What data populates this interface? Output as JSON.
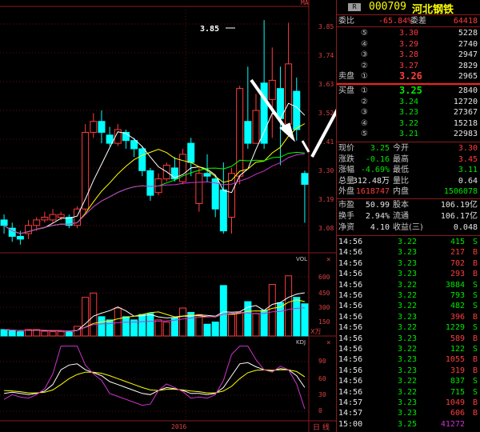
{
  "header": {
    "code": "000709",
    "name": "河北钢铁",
    "badge": "R",
    "top_label": "MA"
  },
  "price_axis": [
    "3.85",
    "3.74",
    "3.63",
    "3.52",
    "3.41",
    "3.30",
    "3.19",
    "3.08"
  ],
  "peak_label": "3.85",
  "vol_axis": {
    "title": "VOL",
    "ticks": [
      "600",
      "450",
      "300",
      "150"
    ],
    "unit": "X万"
  },
  "kdj_axis": {
    "title": "KDJ",
    "ticks": [
      "90",
      "60",
      "30",
      "0"
    ]
  },
  "x_label": "2016",
  "bottom_tabs": [
    "日",
    "线"
  ],
  "webi": {
    "label1": "委比",
    "val1": "-65.84%",
    "label2": "委差",
    "val2": "64418"
  },
  "sell": [
    {
      "n": "⑤",
      "price": "3.30",
      "vol": "5228"
    },
    {
      "n": "④",
      "price": "3.29",
      "vol": "2740"
    },
    {
      "n": "③",
      "price": "3.28",
      "vol": "2947"
    },
    {
      "n": "②",
      "price": "3.27",
      "vol": "2829"
    },
    {
      "n": "①",
      "price": "3.26",
      "vol": "2965",
      "label": "卖盘"
    }
  ],
  "buy": [
    {
      "n": "①",
      "price": "3.25",
      "vol": "2840",
      "label": "买盘"
    },
    {
      "n": "②",
      "price": "3.24",
      "vol": "12720"
    },
    {
      "n": "③",
      "price": "3.23",
      "vol": "27367"
    },
    {
      "n": "④",
      "price": "3.22",
      "vol": "15218"
    },
    {
      "n": "⑤",
      "price": "3.21",
      "vol": "22983"
    }
  ],
  "stats": [
    {
      "l1": "现价",
      "v1": "3.25",
      "l2": "今开",
      "v2": "3.30",
      "c1": "grn",
      "c2": "red"
    },
    {
      "l1": "涨跌",
      "v1": "-0.16",
      "l2": "最高",
      "v2": "3.45",
      "c1": "grn",
      "c2": "red"
    },
    {
      "l1": "涨幅",
      "v1": "-4.69%",
      "l2": "最低",
      "v2": "3.11",
      "c1": "grn",
      "c2": "grn"
    },
    {
      "l1": "总量",
      "v1": "312.48万",
      "l2": "量比",
      "v2": "0.64",
      "c1": "wht",
      "c2": "wht"
    },
    {
      "l1": "外盘",
      "v1": "1618747",
      "l2": "内盘",
      "v2": "1506078",
      "c1": "red",
      "c2": "grn"
    }
  ],
  "stats2": [
    {
      "l1": "市盈",
      "v1": "50.99",
      "l2": "股本",
      "v2": "106.19亿"
    },
    {
      "l1": "换手",
      "v1": "2.94%",
      "l2": "流通",
      "v2": "106.17亿"
    },
    {
      "l1": "净资",
      "v1": "4.10",
      "l2": "收益(三)",
      "v2": "0.048"
    }
  ],
  "ticks": [
    {
      "t": "14:56",
      "p": "3.22",
      "v": "415",
      "s": "S"
    },
    {
      "t": "14:56",
      "p": "3.23",
      "v": "217",
      "s": "B"
    },
    {
      "t": "14:56",
      "p": "3.23",
      "v": "702",
      "s": "B"
    },
    {
      "t": "14:56",
      "p": "3.23",
      "v": "293",
      "s": "B"
    },
    {
      "t": "14:56",
      "p": "3.22",
      "v": "3884",
      "s": "S"
    },
    {
      "t": "14:56",
      "p": "3.22",
      "v": "793",
      "s": "S"
    },
    {
      "t": "14:56",
      "p": "3.22",
      "v": "482",
      "s": "S"
    },
    {
      "t": "14:56",
      "p": "3.23",
      "v": "396",
      "s": "B"
    },
    {
      "t": "14:56",
      "p": "3.22",
      "v": "1229",
      "s": "S"
    },
    {
      "t": "14:56",
      "p": "3.23",
      "v": "589",
      "s": "B"
    },
    {
      "t": "14:56",
      "p": "3.22",
      "v": "122",
      "s": "S"
    },
    {
      "t": "14:56",
      "p": "3.23",
      "v": "1055",
      "s": "B"
    },
    {
      "t": "14:56",
      "p": "3.23",
      "v": "319",
      "s": "B"
    },
    {
      "t": "14:56",
      "p": "3.22",
      "v": "837",
      "s": "S"
    },
    {
      "t": "14:56",
      "p": "3.22",
      "v": "715",
      "s": "S"
    },
    {
      "t": "14:57",
      "p": "3.23",
      "v": "1049",
      "s": "B"
    },
    {
      "t": "14:57",
      "p": "3.23",
      "v": "606",
      "s": "B"
    },
    {
      "t": "15:00",
      "p": "3.25",
      "v": "41272",
      "s": ""
    }
  ],
  "chart_data": {
    "type": "candlestick",
    "ylim": [
      3.0,
      3.9
    ],
    "candles": [
      [
        3.12,
        3.1,
        3.14,
        3.07
      ],
      [
        3.09,
        3.06,
        3.11,
        3.04
      ],
      [
        3.06,
        3.05,
        3.08,
        3.03
      ],
      [
        3.07,
        3.1,
        3.12,
        3.05
      ],
      [
        3.1,
        3.12,
        3.13,
        3.08
      ],
      [
        3.12,
        3.13,
        3.15,
        3.11
      ],
      [
        3.12,
        3.14,
        3.16,
        3.11
      ],
      [
        3.13,
        3.14,
        3.15,
        3.12
      ],
      [
        3.13,
        3.1,
        3.14,
        3.09
      ],
      [
        3.1,
        3.16,
        3.17,
        3.09
      ],
      [
        3.16,
        3.44,
        3.47,
        3.15
      ],
      [
        3.44,
        3.48,
        3.51,
        3.42
      ],
      [
        3.48,
        3.44,
        3.52,
        3.4
      ],
      [
        3.43,
        3.4,
        3.46,
        3.39
      ],
      [
        3.4,
        3.45,
        3.47,
        3.39
      ],
      [
        3.44,
        3.41,
        3.45,
        3.38
      ],
      [
        3.41,
        3.38,
        3.42,
        3.35
      ],
      [
        3.38,
        3.3,
        3.39,
        3.28
      ],
      [
        3.3,
        3.21,
        3.31,
        3.19
      ],
      [
        3.22,
        3.27,
        3.29,
        3.21
      ],
      [
        3.27,
        3.32,
        3.33,
        3.26
      ],
      [
        3.31,
        3.27,
        3.35,
        3.26
      ],
      [
        3.26,
        3.36,
        3.38,
        3.25
      ],
      [
        3.4,
        3.33,
        3.42,
        3.28
      ],
      [
        3.18,
        3.29,
        3.31,
        3.15
      ],
      [
        3.29,
        3.28,
        3.36,
        3.26
      ],
      [
        3.27,
        3.16,
        3.28,
        3.13
      ],
      [
        3.23,
        3.08,
        3.33,
        3.07
      ],
      [
        3.13,
        3.29,
        3.31,
        3.07
      ],
      [
        3.28,
        3.6,
        3.61,
        3.25
      ],
      [
        3.48,
        3.4,
        3.68,
        3.38
      ],
      [
        3.4,
        3.52,
        3.58,
        3.4
      ],
      [
        3.62,
        3.4,
        3.85,
        3.38
      ],
      [
        3.56,
        3.63,
        3.75,
        3.42
      ],
      [
        3.6,
        3.49,
        3.68,
        3.32
      ],
      [
        3.47,
        3.69,
        3.84,
        3.46
      ],
      [
        3.59,
        3.45,
        3.64,
        3.41
      ],
      [
        3.29,
        3.25,
        3.3,
        3.11
      ]
    ]
  }
}
